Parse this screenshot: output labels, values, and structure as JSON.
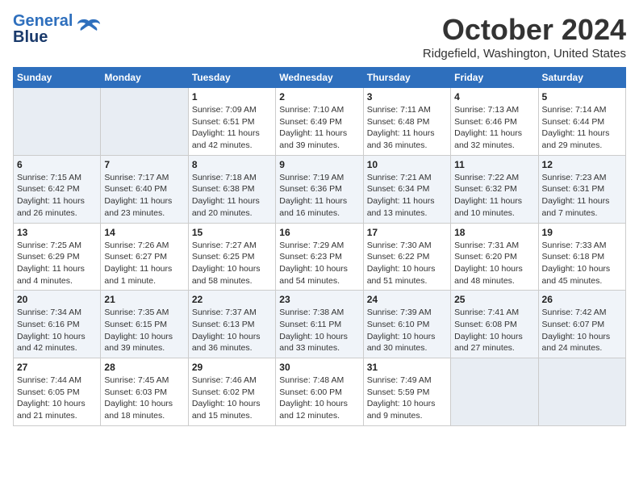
{
  "header": {
    "logo_general": "General",
    "logo_blue": "Blue",
    "month_title": "October 2024",
    "location": "Ridgefield, Washington, United States"
  },
  "weekdays": [
    "Sunday",
    "Monday",
    "Tuesday",
    "Wednesday",
    "Thursday",
    "Friday",
    "Saturday"
  ],
  "weeks": [
    [
      {
        "day": "",
        "info": ""
      },
      {
        "day": "",
        "info": ""
      },
      {
        "day": "1",
        "info": "Sunrise: 7:09 AM\nSunset: 6:51 PM\nDaylight: 11 hours and 42 minutes."
      },
      {
        "day": "2",
        "info": "Sunrise: 7:10 AM\nSunset: 6:49 PM\nDaylight: 11 hours and 39 minutes."
      },
      {
        "day": "3",
        "info": "Sunrise: 7:11 AM\nSunset: 6:48 PM\nDaylight: 11 hours and 36 minutes."
      },
      {
        "day": "4",
        "info": "Sunrise: 7:13 AM\nSunset: 6:46 PM\nDaylight: 11 hours and 32 minutes."
      },
      {
        "day": "5",
        "info": "Sunrise: 7:14 AM\nSunset: 6:44 PM\nDaylight: 11 hours and 29 minutes."
      }
    ],
    [
      {
        "day": "6",
        "info": "Sunrise: 7:15 AM\nSunset: 6:42 PM\nDaylight: 11 hours and 26 minutes."
      },
      {
        "day": "7",
        "info": "Sunrise: 7:17 AM\nSunset: 6:40 PM\nDaylight: 11 hours and 23 minutes."
      },
      {
        "day": "8",
        "info": "Sunrise: 7:18 AM\nSunset: 6:38 PM\nDaylight: 11 hours and 20 minutes."
      },
      {
        "day": "9",
        "info": "Sunrise: 7:19 AM\nSunset: 6:36 PM\nDaylight: 11 hours and 16 minutes."
      },
      {
        "day": "10",
        "info": "Sunrise: 7:21 AM\nSunset: 6:34 PM\nDaylight: 11 hours and 13 minutes."
      },
      {
        "day": "11",
        "info": "Sunrise: 7:22 AM\nSunset: 6:32 PM\nDaylight: 11 hours and 10 minutes."
      },
      {
        "day": "12",
        "info": "Sunrise: 7:23 AM\nSunset: 6:31 PM\nDaylight: 11 hours and 7 minutes."
      }
    ],
    [
      {
        "day": "13",
        "info": "Sunrise: 7:25 AM\nSunset: 6:29 PM\nDaylight: 11 hours and 4 minutes."
      },
      {
        "day": "14",
        "info": "Sunrise: 7:26 AM\nSunset: 6:27 PM\nDaylight: 11 hours and 1 minute."
      },
      {
        "day": "15",
        "info": "Sunrise: 7:27 AM\nSunset: 6:25 PM\nDaylight: 10 hours and 58 minutes."
      },
      {
        "day": "16",
        "info": "Sunrise: 7:29 AM\nSunset: 6:23 PM\nDaylight: 10 hours and 54 minutes."
      },
      {
        "day": "17",
        "info": "Sunrise: 7:30 AM\nSunset: 6:22 PM\nDaylight: 10 hours and 51 minutes."
      },
      {
        "day": "18",
        "info": "Sunrise: 7:31 AM\nSunset: 6:20 PM\nDaylight: 10 hours and 48 minutes."
      },
      {
        "day": "19",
        "info": "Sunrise: 7:33 AM\nSunset: 6:18 PM\nDaylight: 10 hours and 45 minutes."
      }
    ],
    [
      {
        "day": "20",
        "info": "Sunrise: 7:34 AM\nSunset: 6:16 PM\nDaylight: 10 hours and 42 minutes."
      },
      {
        "day": "21",
        "info": "Sunrise: 7:35 AM\nSunset: 6:15 PM\nDaylight: 10 hours and 39 minutes."
      },
      {
        "day": "22",
        "info": "Sunrise: 7:37 AM\nSunset: 6:13 PM\nDaylight: 10 hours and 36 minutes."
      },
      {
        "day": "23",
        "info": "Sunrise: 7:38 AM\nSunset: 6:11 PM\nDaylight: 10 hours and 33 minutes."
      },
      {
        "day": "24",
        "info": "Sunrise: 7:39 AM\nSunset: 6:10 PM\nDaylight: 10 hours and 30 minutes."
      },
      {
        "day": "25",
        "info": "Sunrise: 7:41 AM\nSunset: 6:08 PM\nDaylight: 10 hours and 27 minutes."
      },
      {
        "day": "26",
        "info": "Sunrise: 7:42 AM\nSunset: 6:07 PM\nDaylight: 10 hours and 24 minutes."
      }
    ],
    [
      {
        "day": "27",
        "info": "Sunrise: 7:44 AM\nSunset: 6:05 PM\nDaylight: 10 hours and 21 minutes."
      },
      {
        "day": "28",
        "info": "Sunrise: 7:45 AM\nSunset: 6:03 PM\nDaylight: 10 hours and 18 minutes."
      },
      {
        "day": "29",
        "info": "Sunrise: 7:46 AM\nSunset: 6:02 PM\nDaylight: 10 hours and 15 minutes."
      },
      {
        "day": "30",
        "info": "Sunrise: 7:48 AM\nSunset: 6:00 PM\nDaylight: 10 hours and 12 minutes."
      },
      {
        "day": "31",
        "info": "Sunrise: 7:49 AM\nSunset: 5:59 PM\nDaylight: 10 hours and 9 minutes."
      },
      {
        "day": "",
        "info": ""
      },
      {
        "day": "",
        "info": ""
      }
    ]
  ]
}
